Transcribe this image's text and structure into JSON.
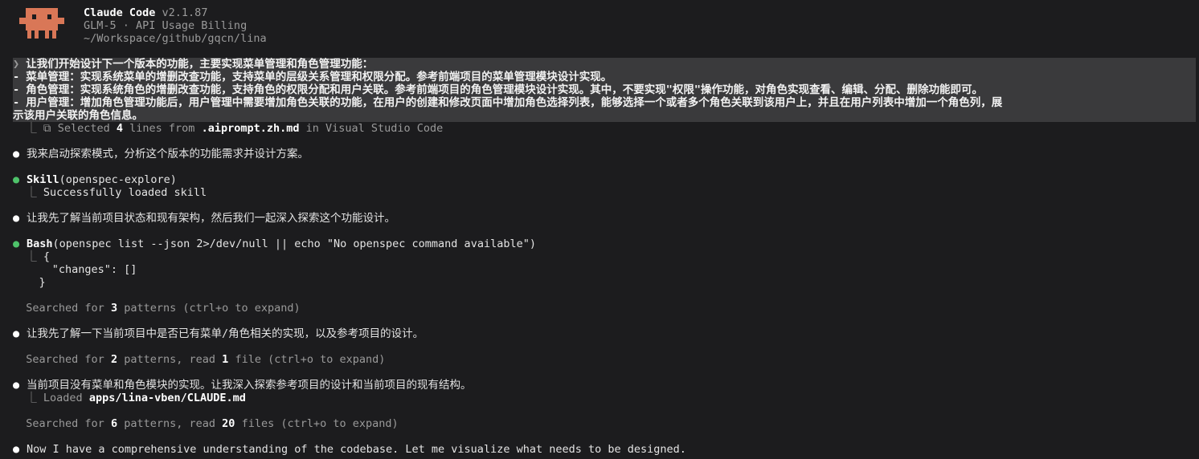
{
  "header": {
    "app_name": "Claude Code",
    "version": "v2.1.87",
    "model_line": "GLM-5 · API Usage Billing",
    "cwd": "~/Workspace/github/gqcn/lina"
  },
  "prompt": {
    "caret": "❯",
    "lines": [
      "让我们开始设计下一个版本的功能，主要实现菜单管理和角色管理功能：",
      "- 菜单管理：实现系统菜单的增删改查功能，支持菜单的层级关系管理和权限分配。参考前端项目的菜单管理模块设计实现。",
      "- 角色管理：实现系统角色的增删改查功能，支持角色的权限分配和用户关联。参考前端项目的角色管理模块设计实现。其中，不要实现\"权限\"操作功能，对角色实现查看、编辑、分配、删除功能即可。",
      "- 用户管理：增加角色管理功能后，用户管理中需要增加角色关联的功能，在用户的创建和修改页面中增加角色选择列表，能够选择一个或者多个角色关联到该用户上，并且在用户列表中增加一个角色列，展",
      "示该用户关联的角色信息。"
    ],
    "selection": {
      "prefix": "Selected",
      "count": "4",
      "middle": "lines from",
      "file": ".aiprompt.zh.md",
      "suffix": "in Visual Studio Code"
    }
  },
  "transcript": {
    "msg1": "我来启动探索模式，分析这个版本的功能需求并设计方案。",
    "skill": {
      "tool": "Skill",
      "args": "(openspec-explore)",
      "result": "Successfully loaded skill"
    },
    "msg2": "让我先了解当前项目状态和现有架构，然后我们一起深入探索这个功能设计。",
    "bash": {
      "tool": "Bash",
      "args": "(openspec list --json 2>/dev/null || echo \"No openspec command available\")",
      "out1": "{",
      "out2": "  \"changes\": []",
      "out3": "}"
    },
    "search1": {
      "a": "Searched for",
      "n": "3",
      "b": "patterns (ctrl+o to expand)"
    },
    "msg3": "让我先了解一下当前项目中是否已有菜单/角色相关的实现，以及参考项目的设计。",
    "search2": {
      "a": "Searched for",
      "n": "2",
      "b": "patterns, read",
      "m": "1",
      "c": "file (ctrl+o to expand)"
    },
    "msg4": "当前项目没有菜单和角色模块的实现。让我深入探索参考项目的设计和当前项目的现有结构。",
    "loaded": {
      "prefix": "Loaded",
      "path": "apps/lina-vben/CLAUDE.md"
    },
    "search3": {
      "a": "Searched for",
      "n": "6",
      "b": "patterns, read",
      "m": "20",
      "c": "files (ctrl+o to expand)"
    },
    "msg5": "Now I have a comprehensive understanding of the codebase. Let me visualize what needs to be designed."
  },
  "colors": {
    "background": "#1c1c1e",
    "prompt_bg": "#3a3a3c",
    "logo": "#d97757",
    "tool_ok": "#4ec26a",
    "dim": "#9a9a9a"
  },
  "icons": [
    "claude-mascot-icon",
    "prompt-caret-icon",
    "tree-branch-icon",
    "selection-icon",
    "bullet-icon"
  ]
}
